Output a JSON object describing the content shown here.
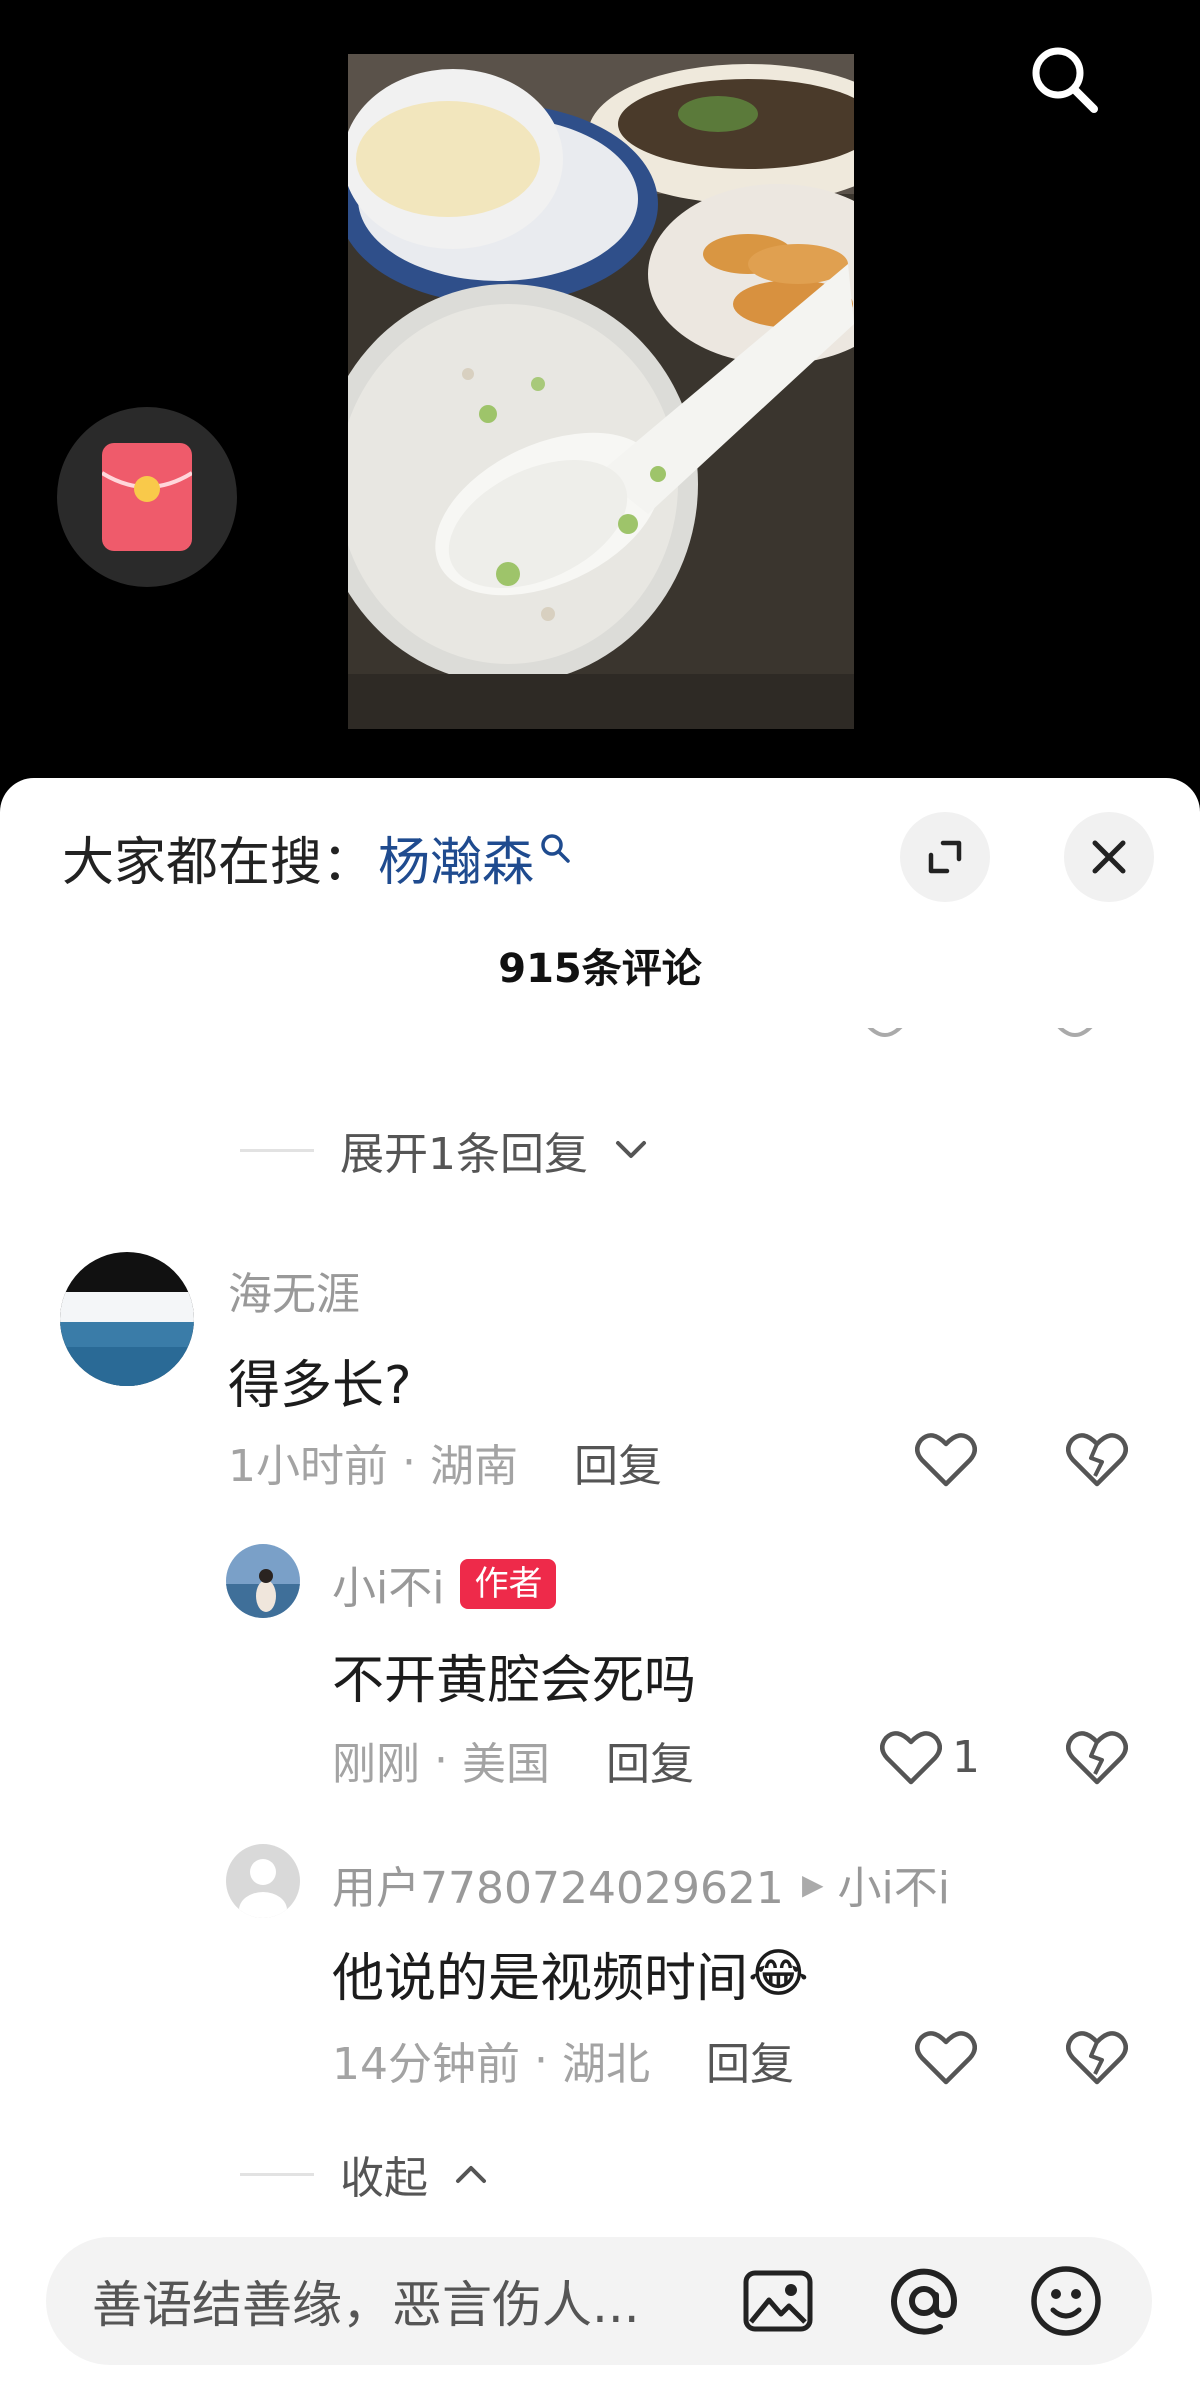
{
  "sheet": {
    "hot_search_prefix": "大家都在搜：",
    "hot_search_term": "杨瀚森",
    "title": "915条评论"
  },
  "thread": {
    "expand_label": "展开1条回复",
    "collapse_label": "收起"
  },
  "comments": [
    {
      "username": "海无涯",
      "text": "得多长?",
      "time": "1小时前",
      "location": "湖南",
      "reply_label": "回复",
      "likes": ""
    }
  ],
  "replies": [
    {
      "username": "小i不i",
      "badge": "作者",
      "text": "不开黄腔会死吗",
      "time": "刚刚",
      "location": "美国",
      "reply_label": "回复",
      "likes": "1"
    },
    {
      "username": "用户7780724029621",
      "reply_to": "小i不i",
      "text": "他说的是视频时间",
      "emoji": "😂",
      "time": "14分钟前",
      "location": "湖北",
      "reply_label": "回复",
      "likes": ""
    }
  ],
  "input": {
    "placeholder": "善语结善缘，恶言伤人..."
  },
  "icons": {
    "search": "search-icon",
    "red_packet": "red-packet-icon",
    "expand": "expand-icon",
    "close": "close-icon",
    "like": "heart-icon",
    "dislike": "broken-heart-icon",
    "image": "image-icon",
    "mention": "at-icon",
    "emoji": "emoji-icon"
  },
  "colors": {
    "background_top": "#000000",
    "sheet_background": "#ffffff",
    "link_blue": "#1f4b8f",
    "author_badge": "#ee2a4a",
    "muted_text": "#a3a3a3",
    "red_packet": "#ef5b6b"
  }
}
